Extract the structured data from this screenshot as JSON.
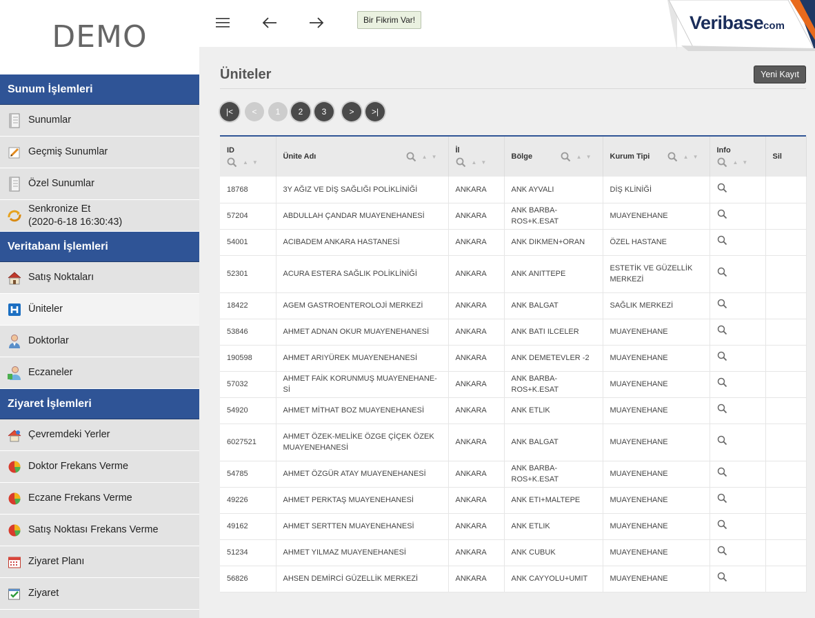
{
  "sidebar": {
    "logo": "DEMO",
    "sections": [
      {
        "title": "Sunum İşlemleri",
        "items": [
          {
            "label": "Sunumlar",
            "icon": "document-icon"
          },
          {
            "label": "Geçmiş Sunumlar",
            "icon": "edit-note-icon"
          },
          {
            "label": "Özel Sunumlar",
            "icon": "document-icon"
          },
          {
            "label": "Senkronize Et",
            "sub": "(2020-6-18 16:30:43)",
            "icon": "sync-icon"
          }
        ]
      },
      {
        "title": "Veritabanı İşlemleri",
        "items": [
          {
            "label": "Satış Noktaları",
            "icon": "store-icon"
          },
          {
            "label": "Üniteler",
            "icon": "hospital-icon",
            "active": true
          },
          {
            "label": "Doktorlar",
            "icon": "doctor-icon"
          },
          {
            "label": "Eczaneler",
            "icon": "pharmacist-icon"
          }
        ]
      },
      {
        "title": "Ziyaret İşlemleri",
        "items": [
          {
            "label": "Çevremdeki Yerler",
            "icon": "nearby-icon"
          },
          {
            "label": "Doktor Frekans Verme",
            "icon": "pie-chart-icon"
          },
          {
            "label": "Eczane Frekans Verme",
            "icon": "pie-chart-icon"
          },
          {
            "label": "Satış Noktası Frekans Verme",
            "icon": "pie-chart-icon"
          },
          {
            "label": "Ziyaret Planı",
            "icon": "calendar-icon"
          },
          {
            "label": "Ziyaret",
            "icon": "checklist-icon"
          }
        ]
      }
    ]
  },
  "topbar": {
    "idea_button": "Bir Fikrim Var!",
    "brand_main": "Veribase",
    "brand_suffix": "com"
  },
  "main": {
    "title": "Üniteler",
    "new_button": "Yeni Kayıt",
    "pager": [
      "|<",
      "<",
      "1",
      "2",
      "3",
      ">",
      ">|"
    ],
    "columns": {
      "id": "ID",
      "name": "Ünite Adı",
      "il": "İl",
      "bolge": "Bölge",
      "kurum": "Kurum Tipi",
      "info": "Info",
      "sil": "Sil"
    },
    "rows": [
      {
        "id": "18768",
        "name": "3Y AĞIZ VE DİŞ SAĞLIĞI POLİKLİNİĞİ",
        "il": "ANKARA",
        "bolge": "ANK AYVALI",
        "kurum": "DİŞ KLİNİĞİ"
      },
      {
        "id": "57204",
        "name": "ABDULLAH ÇANDAR MUAYENEHANESİ",
        "il": "ANKARA",
        "bolge": "ANK BARBA-ROS+K.ESAT",
        "kurum": "MUAYENEHANE"
      },
      {
        "id": "54001",
        "name": "ACIBADEM ANKARA HASTANESİ",
        "il": "ANKARA",
        "bolge": "ANK DIKMEN+ORAN",
        "kurum": "ÖZEL HASTANE"
      },
      {
        "id": "52301",
        "name": "ACURA ESTERA SAĞLIK POLİKLİNİĞİ",
        "il": "ANKARA",
        "bolge": "ANK ANITTEPE",
        "kurum": "ESTETİK VE GÜZELLİK MERKEZİ"
      },
      {
        "id": "18422",
        "name": "AGEM GASTROENTEROLOJİ MERKEZİ",
        "il": "ANKARA",
        "bolge": "ANK BALGAT",
        "kurum": "SAĞLIK MERKEZİ"
      },
      {
        "id": "53846",
        "name": "AHMET ADNAN OKUR MUAYENEHANESİ",
        "il": "ANKARA",
        "bolge": "ANK BATI ILCELER",
        "kurum": "MUAYENEHANE"
      },
      {
        "id": "190598",
        "name": "AHMET ARIYÜREK MUAYENEHANESİ",
        "il": "ANKARA",
        "bolge": "ANK DEMETEVLER -2",
        "kurum": "MUAYENEHANE"
      },
      {
        "id": "57032",
        "name": "AHMET FAİK KORUNMUŞ MUAYENEHANE-Sİ",
        "il": "ANKARA",
        "bolge": "ANK BARBA-ROS+K.ESAT",
        "kurum": "MUAYENEHANE"
      },
      {
        "id": "54920",
        "name": "AHMET MİTHAT BOZ MUAYENEHANESİ",
        "il": "ANKARA",
        "bolge": "ANK ETLIK",
        "kurum": "MUAYENEHANE"
      },
      {
        "id": "6027521",
        "name": "AHMET ÖZEK-MELİKE ÖZGE ÇİÇEK ÖZEK MUAYENEHANESİ",
        "il": "ANKARA",
        "bolge": "ANK BALGAT",
        "kurum": "MUAYENEHANE"
      },
      {
        "id": "54785",
        "name": "AHMET ÖZGÜR ATAY MUAYENEHANESİ",
        "il": "ANKARA",
        "bolge": "ANK BARBA-ROS+K.ESAT",
        "kurum": "MUAYENEHANE"
      },
      {
        "id": "49226",
        "name": "AHMET PERKTAŞ MUAYENEHANESİ",
        "il": "ANKARA",
        "bolge": "ANK ETI+MALTEPE",
        "kurum": "MUAYENEHANE"
      },
      {
        "id": "49162",
        "name": "AHMET SERTTEN MUAYENEHANESİ",
        "il": "ANKARA",
        "bolge": "ANK ETLIK",
        "kurum": "MUAYENEHANE"
      },
      {
        "id": "51234",
        "name": "AHMET YILMAZ MUAYENEHANESİ",
        "il": "ANKARA",
        "bolge": "ANK CUBUK",
        "kurum": "MUAYENEHANE"
      },
      {
        "id": "56826",
        "name": "AHSEN DEMİRCİ GÜZELLİK MERKEZİ",
        "il": "ANKARA",
        "bolge": "ANK CAYYOLU+UMIT",
        "kurum": "MUAYENEHANE"
      }
    ]
  }
}
